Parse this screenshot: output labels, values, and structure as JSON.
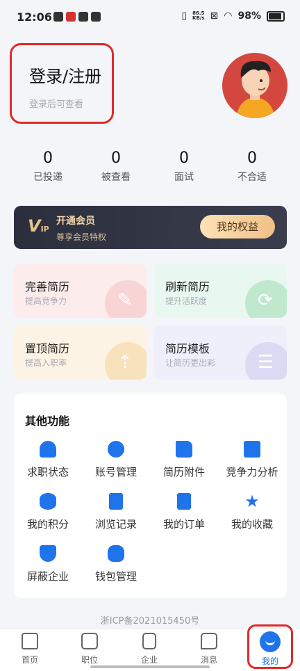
{
  "status_bar": {
    "time": "12:06",
    "speed_value": "86.5",
    "speed_unit": "KB/s",
    "battery": "98%"
  },
  "header": {
    "login_title": "登录/注册",
    "login_subtitle": "登录后可查看"
  },
  "stats": [
    {
      "value": "0",
      "label": "已投递"
    },
    {
      "value": "0",
      "label": "被查看"
    },
    {
      "value": "0",
      "label": "面试"
    },
    {
      "value": "0",
      "label": "不合适"
    }
  ],
  "vip": {
    "logo": "V",
    "logo_small": "IP",
    "title": "开通会员",
    "subtitle": "尊享会员特权",
    "button": "我的权益"
  },
  "cards": [
    {
      "title": "完善简历",
      "subtitle": "提高竞争力",
      "icon": "pencil-icon",
      "color": "#fdecec"
    },
    {
      "title": "刷新简历",
      "subtitle": "提升活跃度",
      "icon": "refresh-icon",
      "color": "#e8f7ef"
    },
    {
      "title": "置顶简历",
      "subtitle": "提高入职率",
      "icon": "pin-top-icon",
      "color": "#fdf3e4"
    },
    {
      "title": "简历模板",
      "subtitle": "让简历更出彩",
      "icon": "template-icon",
      "color": "#efeefb"
    }
  ],
  "other": {
    "title": "其他功能",
    "items": [
      {
        "label": "求职状态",
        "icon": "person-icon"
      },
      {
        "label": "账号管理",
        "icon": "gear-icon"
      },
      {
        "label": "简历附件",
        "icon": "folder-icon"
      },
      {
        "label": "竞争力分析",
        "icon": "chart-monitor-icon"
      },
      {
        "label": "我的积分",
        "icon": "coins-stack-icon"
      },
      {
        "label": "浏览记录",
        "icon": "document-icon"
      },
      {
        "label": "我的订单",
        "icon": "clipboard-icon"
      },
      {
        "label": "我的收藏",
        "icon": "star-icon"
      },
      {
        "label": "屏蔽企业",
        "icon": "shield-block-icon"
      },
      {
        "label": "钱包管理",
        "icon": "wallet-icon"
      }
    ]
  },
  "icp": "浙ICP备2021015450号",
  "tabs": [
    {
      "label": "首页",
      "icon": "home-icon"
    },
    {
      "label": "职位",
      "icon": "briefcase-icon"
    },
    {
      "label": "企业",
      "icon": "building-icon"
    },
    {
      "label": "消息",
      "icon": "message-icon"
    },
    {
      "label": "我的",
      "icon": "profile-smile-icon"
    }
  ],
  "colors": {
    "accent": "#1f74ec",
    "highlight_box": "#e02a2a",
    "vip_gold": "#f0c086"
  }
}
